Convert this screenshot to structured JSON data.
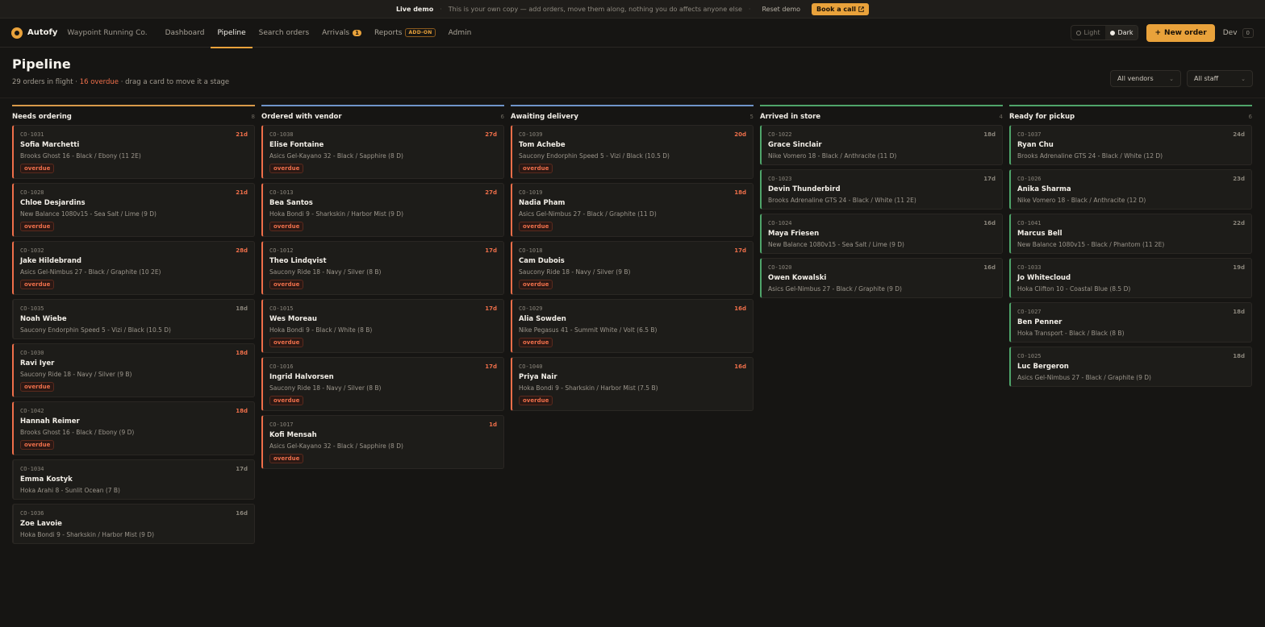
{
  "banner": {
    "live_label": "Live demo",
    "message": "This is your own copy — add orders, move them along, nothing you do affects anyone else",
    "reset_label": "Reset demo",
    "book_label": "Book a call"
  },
  "nav": {
    "brand": "Autofy",
    "store": "Waypoint Running Co.",
    "links": [
      {
        "label": "Dashboard"
      },
      {
        "label": "Pipeline",
        "active": true
      },
      {
        "label": "Search orders"
      },
      {
        "label": "Arrivals",
        "badge": "1"
      },
      {
        "label": "Reports",
        "tag": "ADD-ON"
      },
      {
        "label": "Admin"
      }
    ],
    "theme_light": "Light",
    "theme_dark": "Dark",
    "new_order": "New order",
    "user": "Dev",
    "user_badge": "0"
  },
  "header": {
    "title": "Pipeline",
    "summary_prefix": "29 orders in flight · ",
    "summary_overdue": "16 overdue",
    "summary_suffix": " · drag a card to move it a stage",
    "vendor_filter": "All vendors",
    "staff_filter": "All staff"
  },
  "colors": {
    "accent": "#e9a23b",
    "overdue": "#ef6f4a",
    "needs_ordering": "#d99a4a",
    "ordered": "#6f94c9",
    "awaiting": "#6f94c9",
    "arrived": "#4fa56a",
    "ready": "#4fa56a"
  },
  "overdue_label": "overdue",
  "columns": [
    {
      "key": "needs_ordering",
      "title": "Needs ordering",
      "count": "8",
      "color": "#d99a4a",
      "cards": [
        {
          "id": "CO-1031",
          "age": "21d",
          "name": "Sofia Marchetti",
          "item": "Brooks Ghost 16 - Black / Ebony (11 2E)",
          "overdue": true
        },
        {
          "id": "CO-1028",
          "age": "21d",
          "name": "Chloe Desjardins",
          "item": "New Balance 1080v15 - Sea Salt / Lime (9 D)",
          "overdue": true
        },
        {
          "id": "CO-1032",
          "age": "28d",
          "name": "Jake Hildebrand",
          "item": "Asics Gel-Nimbus 27 - Black / Graphite (10 2E)",
          "overdue": true
        },
        {
          "id": "CO-1035",
          "age": "18d",
          "name": "Noah Wiebe",
          "item": "Saucony Endorphin Speed 5 - Vizi / Black (10.5 D)",
          "overdue": false
        },
        {
          "id": "CO-1030",
          "age": "18d",
          "name": "Ravi Iyer",
          "item": "Saucony Ride 18 - Navy / Silver (9 B)",
          "overdue": true
        },
        {
          "id": "CO-1042",
          "age": "18d",
          "name": "Hannah Reimer",
          "item": "Brooks Ghost 16 - Black / Ebony (9 D)",
          "overdue": true
        },
        {
          "id": "CO-1034",
          "age": "17d",
          "name": "Emma Kostyk",
          "item": "Hoka Arahi 8 - Sunlit Ocean (7 B)",
          "overdue": false
        },
        {
          "id": "CO-1036",
          "age": "16d",
          "name": "Zoe Lavoie",
          "item": "Hoka Bondi 9 - Sharkskin / Harbor Mist (9 D)",
          "overdue": false
        }
      ]
    },
    {
      "key": "ordered",
      "title": "Ordered with vendor",
      "count": "6",
      "color": "#6f94c9",
      "cards": [
        {
          "id": "CO-1038",
          "age": "27d",
          "name": "Elise Fontaine",
          "item": "Asics Gel-Kayano 32 - Black / Sapphire (8 D)",
          "overdue": true
        },
        {
          "id": "CO-1013",
          "age": "27d",
          "name": "Bea Santos",
          "item": "Hoka Bondi 9 - Sharkskin / Harbor Mist (9 D)",
          "overdue": true
        },
        {
          "id": "CO-1012",
          "age": "17d",
          "name": "Theo Lindqvist",
          "item": "Saucony Ride 18 - Navy / Silver (8 B)",
          "overdue": true
        },
        {
          "id": "CO-1015",
          "age": "17d",
          "name": "Wes Moreau",
          "item": "Hoka Bondi 9 - Black / White (8 B)",
          "overdue": true
        },
        {
          "id": "CO-1016",
          "age": "17d",
          "name": "Ingrid Halvorsen",
          "item": "Saucony Ride 18 - Navy / Silver (8 B)",
          "overdue": true
        },
        {
          "id": "CO-1017",
          "age": "1d",
          "name": "Kofi Mensah",
          "item": "Asics Gel-Kayano 32 - Black / Sapphire (8 D)",
          "overdue": true
        }
      ]
    },
    {
      "key": "awaiting",
      "title": "Awaiting delivery",
      "count": "5",
      "color": "#6f94c9",
      "cards": [
        {
          "id": "CO-1039",
          "age": "20d",
          "name": "Tom Achebe",
          "item": "Saucony Endorphin Speed 5 - Vizi / Black (10.5 D)",
          "overdue": true
        },
        {
          "id": "CO-1019",
          "age": "18d",
          "name": "Nadia Pham",
          "item": "Asics Gel-Nimbus 27 - Black / Graphite (11 D)",
          "overdue": true
        },
        {
          "id": "CO-1018",
          "age": "17d",
          "name": "Cam Dubois",
          "item": "Saucony Ride 18 - Navy / Silver (9 B)",
          "overdue": true
        },
        {
          "id": "CO-1029",
          "age": "16d",
          "name": "Alia Sowden",
          "item": "Nike Pegasus 41 - Summit White / Volt (6.5 B)",
          "overdue": true
        },
        {
          "id": "CO-1040",
          "age": "16d",
          "name": "Priya Nair",
          "item": "Hoka Bondi 9 - Sharkskin / Harbor Mist (7.5 B)",
          "overdue": true
        }
      ]
    },
    {
      "key": "arrived",
      "title": "Arrived in store",
      "count": "4",
      "color": "#4fa56a",
      "cards": [
        {
          "id": "CO-1022",
          "age": "18d",
          "name": "Grace Sinclair",
          "item": "Nike Vomero 18 - Black / Anthracite (11 D)",
          "overdue": false
        },
        {
          "id": "CO-1023",
          "age": "17d",
          "name": "Devin Thunderbird",
          "item": "Brooks Adrenaline GTS 24 - Black / White (11 2E)",
          "overdue": false
        },
        {
          "id": "CO-1024",
          "age": "16d",
          "name": "Maya Friesen",
          "item": "New Balance 1080v15 - Sea Salt / Lime (9 D)",
          "overdue": false
        },
        {
          "id": "CO-1020",
          "age": "16d",
          "name": "Owen Kowalski",
          "item": "Asics Gel-Nimbus 27 - Black / Graphite (9 D)",
          "overdue": false
        }
      ]
    },
    {
      "key": "ready",
      "title": "Ready for pickup",
      "count": "6",
      "color": "#4fa56a",
      "cards": [
        {
          "id": "CO-1037",
          "age": "24d",
          "name": "Ryan Chu",
          "item": "Brooks Adrenaline GTS 24 - Black / White (12 D)",
          "overdue": false
        },
        {
          "id": "CO-1026",
          "age": "23d",
          "name": "Anika Sharma",
          "item": "Nike Vomero 18 - Black / Anthracite (12 D)",
          "overdue": false
        },
        {
          "id": "CO-1041",
          "age": "22d",
          "name": "Marcus Bell",
          "item": "New Balance 1080v15 - Black / Phantom (11 2E)",
          "overdue": false
        },
        {
          "id": "CO-1033",
          "age": "19d",
          "name": "Jo Whitecloud",
          "item": "Hoka Clifton 10 - Coastal Blue (8.5 D)",
          "overdue": false
        },
        {
          "id": "CO-1027",
          "age": "18d",
          "name": "Ben Penner",
          "item": "Hoka Transport - Black / Black (8 B)",
          "overdue": false
        },
        {
          "id": "CO-1025",
          "age": "18d",
          "name": "Luc Bergeron",
          "item": "Asics Gel-Nimbus 27 - Black / Graphite (9 D)",
          "overdue": false
        }
      ]
    }
  ]
}
